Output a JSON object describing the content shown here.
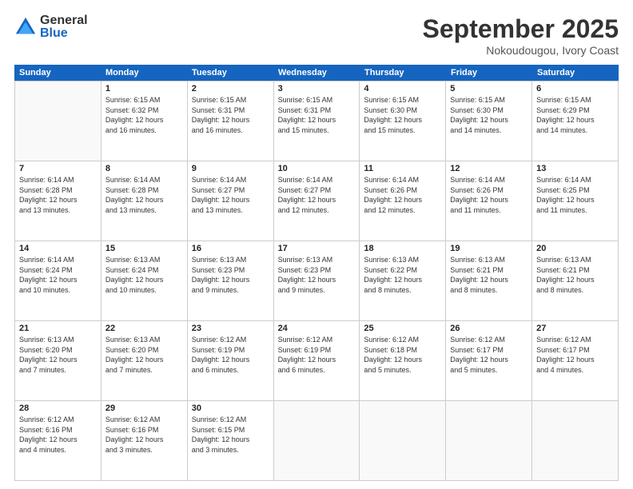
{
  "logo": {
    "general": "General",
    "blue": "Blue"
  },
  "header": {
    "month": "September 2025",
    "location": "Nokoudougou, Ivory Coast"
  },
  "weekdays": [
    "Sunday",
    "Monday",
    "Tuesday",
    "Wednesday",
    "Thursday",
    "Friday",
    "Saturday"
  ],
  "weeks": [
    [
      {
        "day": "",
        "info": ""
      },
      {
        "day": "1",
        "info": "Sunrise: 6:15 AM\nSunset: 6:32 PM\nDaylight: 12 hours\nand 16 minutes."
      },
      {
        "day": "2",
        "info": "Sunrise: 6:15 AM\nSunset: 6:31 PM\nDaylight: 12 hours\nand 16 minutes."
      },
      {
        "day": "3",
        "info": "Sunrise: 6:15 AM\nSunset: 6:31 PM\nDaylight: 12 hours\nand 15 minutes."
      },
      {
        "day": "4",
        "info": "Sunrise: 6:15 AM\nSunset: 6:30 PM\nDaylight: 12 hours\nand 15 minutes."
      },
      {
        "day": "5",
        "info": "Sunrise: 6:15 AM\nSunset: 6:30 PM\nDaylight: 12 hours\nand 14 minutes."
      },
      {
        "day": "6",
        "info": "Sunrise: 6:15 AM\nSunset: 6:29 PM\nDaylight: 12 hours\nand 14 minutes."
      }
    ],
    [
      {
        "day": "7",
        "info": "Sunrise: 6:14 AM\nSunset: 6:28 PM\nDaylight: 12 hours\nand 13 minutes."
      },
      {
        "day": "8",
        "info": "Sunrise: 6:14 AM\nSunset: 6:28 PM\nDaylight: 12 hours\nand 13 minutes."
      },
      {
        "day": "9",
        "info": "Sunrise: 6:14 AM\nSunset: 6:27 PM\nDaylight: 12 hours\nand 13 minutes."
      },
      {
        "day": "10",
        "info": "Sunrise: 6:14 AM\nSunset: 6:27 PM\nDaylight: 12 hours\nand 12 minutes."
      },
      {
        "day": "11",
        "info": "Sunrise: 6:14 AM\nSunset: 6:26 PM\nDaylight: 12 hours\nand 12 minutes."
      },
      {
        "day": "12",
        "info": "Sunrise: 6:14 AM\nSunset: 6:26 PM\nDaylight: 12 hours\nand 11 minutes."
      },
      {
        "day": "13",
        "info": "Sunrise: 6:14 AM\nSunset: 6:25 PM\nDaylight: 12 hours\nand 11 minutes."
      }
    ],
    [
      {
        "day": "14",
        "info": "Sunrise: 6:14 AM\nSunset: 6:24 PM\nDaylight: 12 hours\nand 10 minutes."
      },
      {
        "day": "15",
        "info": "Sunrise: 6:13 AM\nSunset: 6:24 PM\nDaylight: 12 hours\nand 10 minutes."
      },
      {
        "day": "16",
        "info": "Sunrise: 6:13 AM\nSunset: 6:23 PM\nDaylight: 12 hours\nand 9 minutes."
      },
      {
        "day": "17",
        "info": "Sunrise: 6:13 AM\nSunset: 6:23 PM\nDaylight: 12 hours\nand 9 minutes."
      },
      {
        "day": "18",
        "info": "Sunrise: 6:13 AM\nSunset: 6:22 PM\nDaylight: 12 hours\nand 8 minutes."
      },
      {
        "day": "19",
        "info": "Sunrise: 6:13 AM\nSunset: 6:21 PM\nDaylight: 12 hours\nand 8 minutes."
      },
      {
        "day": "20",
        "info": "Sunrise: 6:13 AM\nSunset: 6:21 PM\nDaylight: 12 hours\nand 8 minutes."
      }
    ],
    [
      {
        "day": "21",
        "info": "Sunrise: 6:13 AM\nSunset: 6:20 PM\nDaylight: 12 hours\nand 7 minutes."
      },
      {
        "day": "22",
        "info": "Sunrise: 6:13 AM\nSunset: 6:20 PM\nDaylight: 12 hours\nand 7 minutes."
      },
      {
        "day": "23",
        "info": "Sunrise: 6:12 AM\nSunset: 6:19 PM\nDaylight: 12 hours\nand 6 minutes."
      },
      {
        "day": "24",
        "info": "Sunrise: 6:12 AM\nSunset: 6:19 PM\nDaylight: 12 hours\nand 6 minutes."
      },
      {
        "day": "25",
        "info": "Sunrise: 6:12 AM\nSunset: 6:18 PM\nDaylight: 12 hours\nand 5 minutes."
      },
      {
        "day": "26",
        "info": "Sunrise: 6:12 AM\nSunset: 6:17 PM\nDaylight: 12 hours\nand 5 minutes."
      },
      {
        "day": "27",
        "info": "Sunrise: 6:12 AM\nSunset: 6:17 PM\nDaylight: 12 hours\nand 4 minutes."
      }
    ],
    [
      {
        "day": "28",
        "info": "Sunrise: 6:12 AM\nSunset: 6:16 PM\nDaylight: 12 hours\nand 4 minutes."
      },
      {
        "day": "29",
        "info": "Sunrise: 6:12 AM\nSunset: 6:16 PM\nDaylight: 12 hours\nand 3 minutes."
      },
      {
        "day": "30",
        "info": "Sunrise: 6:12 AM\nSunset: 6:15 PM\nDaylight: 12 hours\nand 3 minutes."
      },
      {
        "day": "",
        "info": ""
      },
      {
        "day": "",
        "info": ""
      },
      {
        "day": "",
        "info": ""
      },
      {
        "day": "",
        "info": ""
      }
    ]
  ]
}
